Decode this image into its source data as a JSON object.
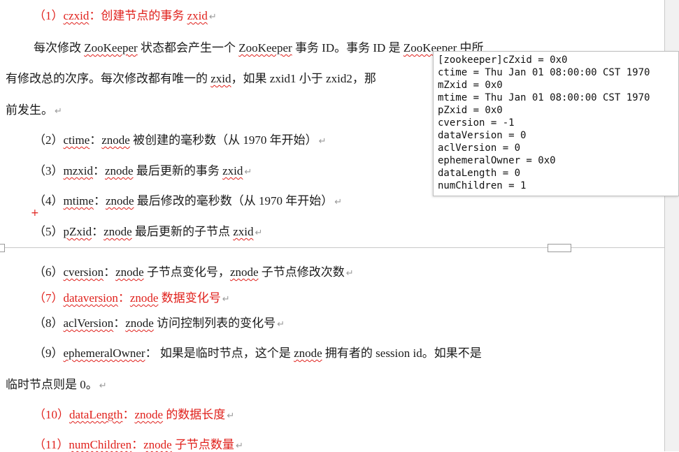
{
  "items": [
    {
      "num": "（1）",
      "field": "czxid",
      "sep": "：",
      "desc": "创建节点的事务 ",
      "tail": "zxid"
    },
    {
      "num": "（2）",
      "field": "ctime",
      "sep": "：",
      "noun": "znode",
      "desc": " 被创建的毫秒数（从 1970 年开始）"
    },
    {
      "num": "（3）",
      "field": "mzxid",
      "sep": "：",
      "noun": "znode",
      "desc": " 最后更新的事务 ",
      "tail": "zxid"
    },
    {
      "num": "（4）",
      "field": "mtime",
      "sep": "：",
      "noun": "znode",
      "desc": " 最后修改的毫秒数（从 1970 年开始）"
    },
    {
      "num": "（5）",
      "field": "pZxid",
      "sep": "：",
      "noun": "znode",
      "desc": " 最后更新的子节点 ",
      "tail": "zxid"
    },
    {
      "num": "（6）",
      "field": "cversion",
      "sep": "：",
      "noun": "znode",
      "desc": " 子节点变化号，",
      "noun2": "znode",
      "desc2": " 子节点修改次数"
    },
    {
      "num": "（7）",
      "field": "dataversion",
      "sep": "：",
      "noun": "znode",
      "desc": " 数据变化号"
    },
    {
      "num": "（8）",
      "field": "aclVersion",
      "sep": "：",
      "noun": "znode",
      "desc": " 访问控制列表的变化号"
    },
    {
      "num": "（9）",
      "field": "ephemeralOwner",
      "sep": "：",
      "desc": " 如果是临时节点，这个是 ",
      "noun": "znode",
      "desc2": " 拥有者的 session id。如果不是"
    },
    {
      "num": "（10）",
      "field": "dataLength",
      "sep": "：",
      "noun": "znode",
      "desc": " 的数据长度"
    },
    {
      "num": "（11）",
      "field": "numChildren",
      "sep": "：",
      "noun": "znode",
      "desc": " 子节点数量"
    }
  ],
  "para1": {
    "line1_a": "每次修改 ",
    "line1_b": "ZooKeeper",
    "line1_c": " 状态都会产生一个 ",
    "line1_d": "ZooKeeper",
    "line1_e": " 事务 ID。事务 ID 是 ",
    "line1_f": "ZooKeeper",
    "line1_g": " 中所",
    "line2_a": "有修改总的次序。每次修改都有唯一的 ",
    "line2_b": "zxid",
    "line2_c": "，如果 zxid1 小于 zxid2，那",
    "line3": "前发生。"
  },
  "item9_continuation": "临时节点则是 0。",
  "return_mark": "↵",
  "cursor_mark": "+",
  "terminal": {
    "lines": [
      "[zookeeper]cZxid = 0x0",
      "ctime = Thu Jan 01 08:00:00 CST 1970",
      "mZxid = 0x0",
      "mtime = Thu Jan 01 08:00:00 CST 1970",
      "pZxid = 0x0",
      "cversion = -1",
      "dataVersion = 0",
      "aclVersion = 0",
      "ephemeralOwner = 0x0",
      "dataLength = 0",
      "numChildren = 1"
    ]
  },
  "colors": {
    "highlight": "#e0201b",
    "text": "#1a1a1a",
    "return_mark": "#9a9a9a"
  }
}
